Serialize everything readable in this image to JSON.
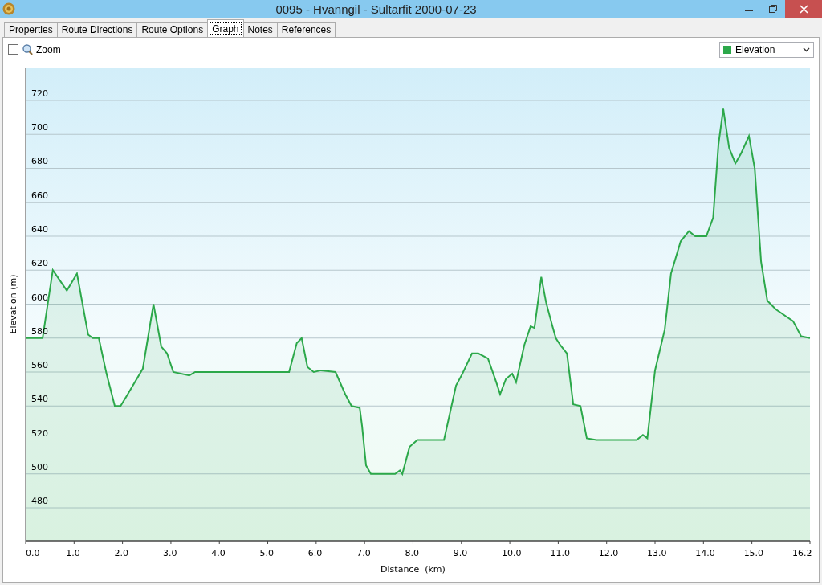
{
  "window": {
    "title": "0095 - Hvanngil - Sultarfit 2000-07-23"
  },
  "tabs": [
    {
      "label": "Properties",
      "selected": false
    },
    {
      "label": "Route Directions",
      "selected": false
    },
    {
      "label": "Route Options",
      "selected": false
    },
    {
      "label": "Graph",
      "selected": true
    },
    {
      "label": "Notes",
      "selected": false
    },
    {
      "label": "References",
      "selected": false
    }
  ],
  "toolbar": {
    "zoom": {
      "label": "Zoom",
      "checked": false
    }
  },
  "graph": {
    "chart_data": {
      "type": "area",
      "xlabel": "Distance  (km)",
      "ylabel": "Elevation (m)",
      "x": [
        0,
        0.35,
        0.56,
        0.85,
        1.06,
        1.29,
        1.39,
        1.51,
        1.67,
        1.84,
        1.96,
        2.09,
        2.42,
        2.64,
        2.8,
        2.92,
        3.05,
        3.38,
        3.5,
        5.44,
        5.6,
        5.7,
        5.82,
        5.95,
        6.1,
        6.4,
        6.6,
        6.73,
        6.9,
        6.95,
        7.03,
        7.13,
        7.63,
        7.73,
        7.78,
        7.93,
        8.09,
        8.64,
        8.89,
        9.02,
        9.22,
        9.35,
        9.55,
        9.72,
        9.8,
        9.92,
        10.05,
        10.13,
        10.3,
        10.43,
        10.51,
        10.65,
        10.75,
        10.88,
        10.95,
        11.04,
        11.18,
        11.31,
        11.46,
        11.59,
        11.79,
        12.62,
        12.75,
        12.84,
        13.0,
        13.2,
        13.33,
        13.53,
        13.7,
        13.83,
        14.06,
        14.2,
        14.31,
        14.41,
        14.53,
        14.66,
        14.78,
        14.94,
        15.06,
        15.19,
        15.32,
        15.49,
        15.85,
        16.02,
        16.2
      ],
      "series": [
        {
          "name": "Elevation",
          "color": "#2ca84a",
          "values": [
            580,
            580,
            620,
            608,
            618,
            582,
            580,
            580,
            559,
            540,
            540,
            546,
            562,
            600,
            575,
            571,
            560,
            558,
            560,
            560,
            577,
            580,
            563,
            560,
            561,
            560,
            547,
            540,
            539,
            528,
            505,
            500,
            500,
            502,
            500,
            516,
            520,
            520,
            552,
            559,
            571,
            571,
            568,
            554,
            547,
            556,
            559,
            554,
            576,
            587,
            586,
            616,
            601,
            587,
            580,
            576,
            571,
            541,
            540,
            521,
            520,
            520,
            523,
            521,
            561,
            585,
            618,
            637,
            643,
            640,
            640,
            651,
            694,
            715,
            692,
            683,
            689,
            699,
            680,
            625,
            602,
            597,
            590,
            581,
            580
          ]
        }
      ],
      "grid": true,
      "xlim": [
        0,
        16.2
      ],
      "ylim": [
        460.6,
        739.4
      ],
      "xticks": [
        {
          "value": 0,
          "label": "0.0"
        },
        {
          "value": 1,
          "label": "1.0"
        },
        {
          "value": 2,
          "label": "2.0"
        },
        {
          "value": 3,
          "label": "3.0"
        },
        {
          "value": 4,
          "label": "4.0"
        },
        {
          "value": 5,
          "label": "5.0"
        },
        {
          "value": 6,
          "label": "6.0"
        },
        {
          "value": 7,
          "label": "7.0"
        },
        {
          "value": 8,
          "label": "8.0"
        },
        {
          "value": 9,
          "label": "9.0"
        },
        {
          "value": 10,
          "label": "10.0"
        },
        {
          "value": 11,
          "label": "11.0"
        },
        {
          "value": 12,
          "label": "12.0"
        },
        {
          "value": 13,
          "label": "13.0"
        },
        {
          "value": 14,
          "label": "14.0"
        },
        {
          "value": 15,
          "label": "15.0"
        },
        {
          "value": 16.2,
          "label": "16.2"
        }
      ],
      "yticks": [
        480,
        500,
        520,
        540,
        560,
        580,
        600,
        620,
        640,
        660,
        680,
        700,
        720
      ]
    }
  }
}
